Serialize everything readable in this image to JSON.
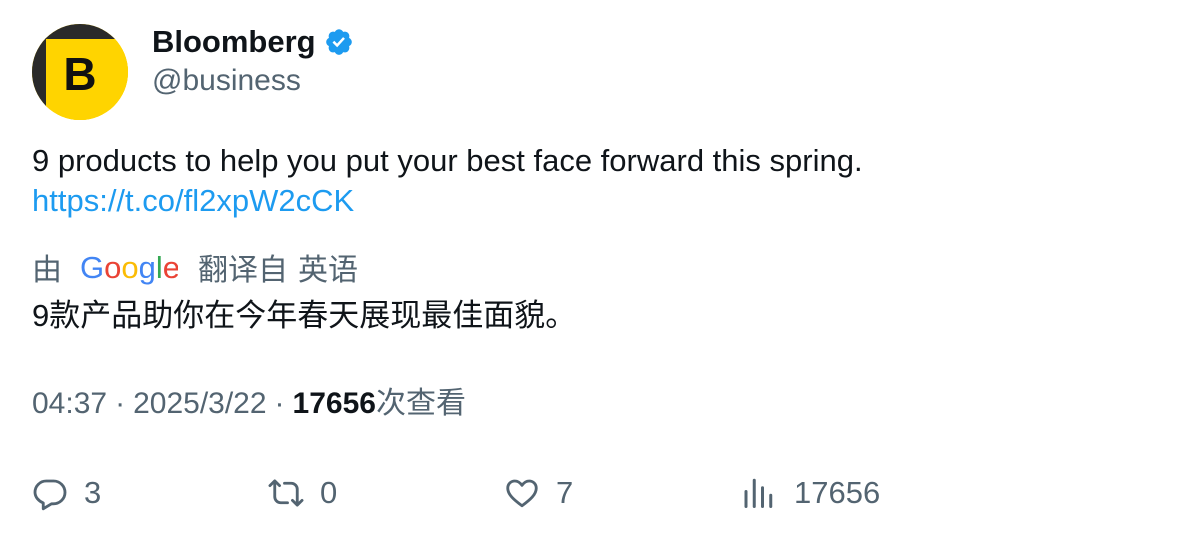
{
  "author": {
    "name": "Bloomberg",
    "handle": "@business",
    "avatar_letter": "B",
    "verified": true
  },
  "tweet": {
    "text": "9 products to help you put your best face forward this spring.",
    "link": "https://t.co/fl2xpW2cCK"
  },
  "translation": {
    "by_label": "由",
    "provider": "Google",
    "translated_from_label": "翻译自",
    "source_language": "英语",
    "text": "9款产品助你在今年春天展现最佳面貌。"
  },
  "meta": {
    "time": "04:37",
    "separator": "·",
    "date": "2025/3/22",
    "views": "17656",
    "views_label": "次查看"
  },
  "actions": {
    "reply_count": "3",
    "retweet_count": "0",
    "like_count": "7",
    "view_count": "17656"
  },
  "colors": {
    "link": "#1d9bf0",
    "secondary_text": "#536471",
    "primary_text": "#0f1419",
    "avatar_yellow": "#ffd400",
    "verified_blue": "#1d9bf0"
  }
}
